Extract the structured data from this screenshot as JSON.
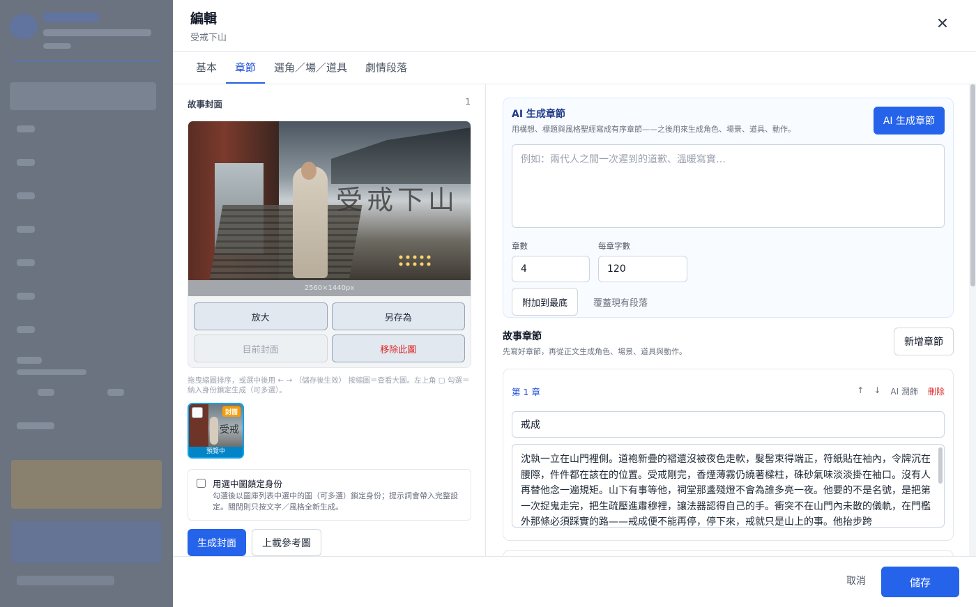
{
  "modal": {
    "title": "編輯",
    "subtitle": "受戒下山"
  },
  "tabs": [
    {
      "label": "基本",
      "active": false
    },
    {
      "label": "章節",
      "active": true
    },
    {
      "label": "選角／場／道具",
      "active": false
    },
    {
      "label": "劇情段落",
      "active": false
    }
  ],
  "cover": {
    "label": "故事封面",
    "count": "1",
    "image_title": "受戒下山",
    "dimensions": "2560×1440px",
    "actions": {
      "zoom": "放大",
      "save_as": "另存為",
      "current_cover": "目前封面",
      "remove": "移除此圖"
    },
    "hint": "拖曳縮圖排序，或選中後用 ← → （儲存後生效） 按縮圖＝查看大圖。左上角 ▢ 勾選＝納入身份鎖定生成（可多選）。",
    "thumbnail": {
      "badge": "封面",
      "status": "預覽中",
      "text": "受戒"
    },
    "lock": {
      "title": "用選中圖鎖定身份",
      "desc": "勾選後以圖庫列表中選中的圖（可多選）鎖定身份；提示詞會帶入完整設定。關閉則只按文字／風格全新生成。",
      "checked": false
    },
    "generate_label": "生成封面",
    "upload_label": "上載參考圖"
  },
  "ai_generate": {
    "title": "AI 生成章節",
    "desc": "用構想、標題與風格聖經寫成有序章節——之後用來生成角色、場景、道具、動作。",
    "button": "AI 生成章節",
    "placeholder": "例如：兩代人之間一次遲到的道歉、溫暖寫實…",
    "chapters_label": "章數",
    "chapters_value": "4",
    "words_label": "每章字數",
    "words_value": "120",
    "append_label": "附加到最底",
    "overwrite_label": "覆蓋現有段落"
  },
  "story": {
    "title": "故事章節",
    "desc": "先寫好章節，再從正文生成角色、場景、道具與動作。",
    "add_label": "新增章節",
    "chapters": [
      {
        "num": "第 1 章",
        "up": "↑",
        "down": "↓",
        "polish": "AI 潤飾",
        "delete": "刪除",
        "title": "戒成",
        "body": "沈執一立在山門裡側。道袍新疊的褶還沒被夜色走軟，髮髻束得端正，符紙貼在袖內，令牌沉在腰際，件件都在該在的位置。受戒剛完，香煙薄霧仍繞著樑柱，硃砂氣味淡淡掛在袖口。沒有人再替他念一遍規矩。山下有事等他，祠堂那盞殘燈不會為誰多亮一夜。他要的不是名號，是把第一次捉鬼走完，把生疏壓進肅穆裡，讓法器認得自己的手。衝突不在山門內未散的儀軌，在門檻外那條必須踩實的路——戒成便不能再停，停下來，戒就只是山上的事。他抬步跨"
      }
    ]
  },
  "footer": {
    "cancel": "取消",
    "save": "儲存"
  }
}
